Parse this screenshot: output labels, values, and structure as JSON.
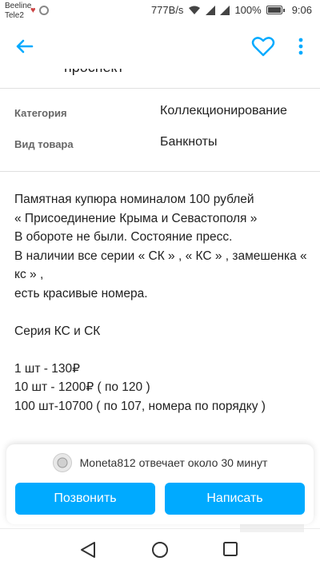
{
  "status_bar": {
    "carrier1": "Beeline",
    "carrier2": "Tele2",
    "speed": "777B/s",
    "battery": "100%",
    "time": "9:06"
  },
  "appbar": {
    "back_icon": "arrow-left-icon",
    "favorite_icon": "heart-icon",
    "more_icon": "more-vertical-icon",
    "accent_color": "#00aaff"
  },
  "content": {
    "cut_text": "проспект",
    "properties": [
      {
        "key": "Категория",
        "value": "Коллекционирование"
      },
      {
        "key": "Вид товара",
        "value": "Банкноты"
      }
    ],
    "description": [
      "Памятная купюра номиналом 100 рублей",
      "« Присоединение Крыма и Севастополя »",
      "В обороте не были.  Состояние пресс.",
      "В наличии все серии « СК » , « КС » , замешенка «",
      "кс » ,",
      "есть красивые номера.",
      "",
      "Серия КС и СК",
      "",
      "1 шт -  130₽",
      "10 шт - 1200₽ ( по 120 )",
      "100 шт-10700 ( по 107, номера по порядку )"
    ]
  },
  "seller": {
    "text": "Moneta812 отвечает около 30 минут"
  },
  "actions": {
    "call_label": "Позвонить",
    "message_label": "Написать",
    "button_color": "#00aaff"
  }
}
